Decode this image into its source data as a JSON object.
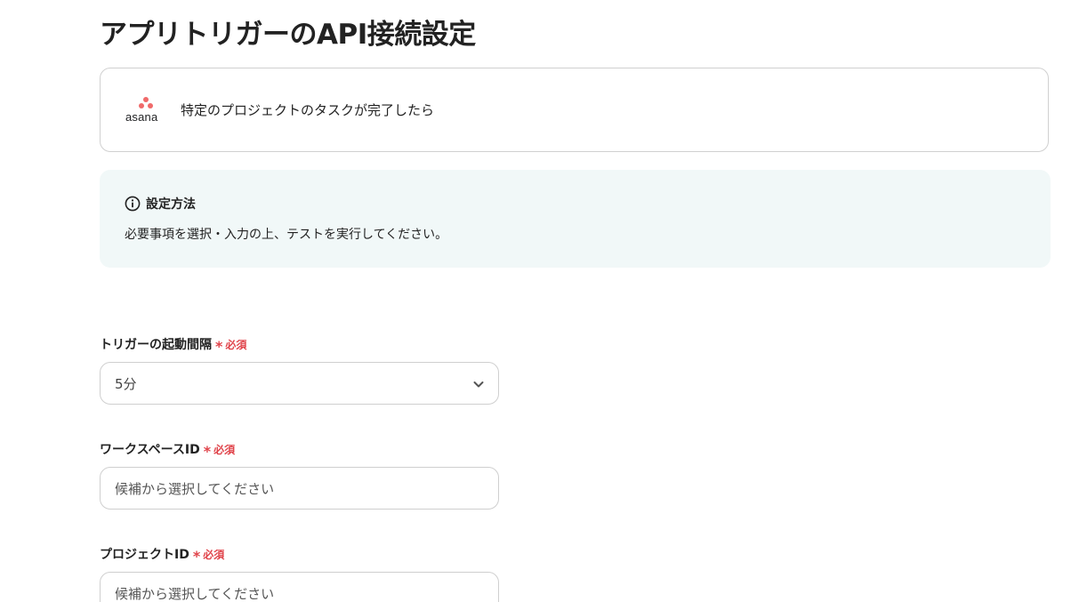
{
  "page": {
    "title": "アプリトリガーのAPI接続設定"
  },
  "app_card": {
    "app_name": "asana",
    "trigger_label": "特定のプロジェクトのタスクが完了したら",
    "brand_color": "#f06a6a"
  },
  "info": {
    "icon": "info-circle-icon",
    "title": "設定方法",
    "text": "必要事項を選択・入力の上、テストを実行してください。",
    "background": "#f1f8f8"
  },
  "fields": {
    "interval": {
      "label": "トリガーの起動間隔",
      "required_mark": "*",
      "required_text": "必須",
      "value": "5分",
      "icon": "chevron-down-icon"
    },
    "workspace": {
      "label": "ワークスペースID",
      "required_mark": "*",
      "required_text": "必須",
      "placeholder": "候補から選択してください"
    },
    "project": {
      "label": "プロジェクトID",
      "required_mark": "*",
      "required_text": "必須",
      "placeholder": "候補から選択してください"
    }
  },
  "colors": {
    "required": "#e0434a",
    "border": "#cfcfcf"
  }
}
